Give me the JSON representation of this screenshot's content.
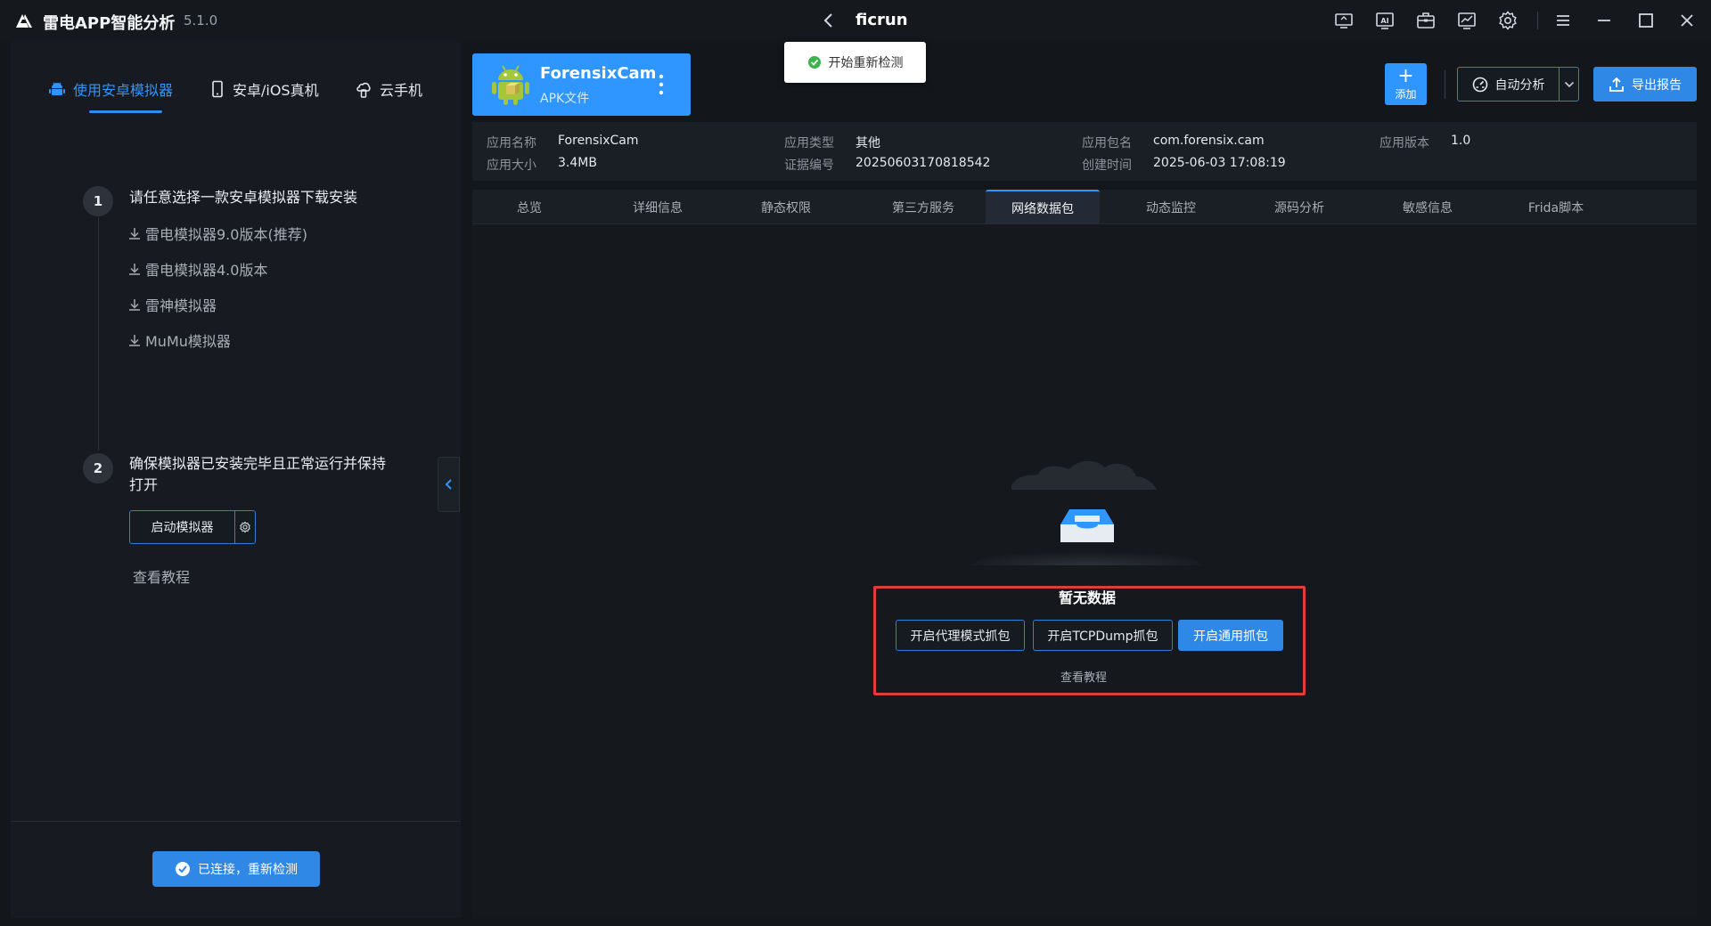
{
  "titlebar": {
    "app_name": "雷电APP智能分析",
    "version": "5.1.0",
    "project_name": "ficrun",
    "icons": [
      "screen-cast-icon",
      "ai-icon",
      "toolbox-icon",
      "monitor-chart-icon",
      "settings-icon",
      "menu-icon",
      "minimize-icon",
      "maximize-icon",
      "close-icon"
    ]
  },
  "left": {
    "tabs": [
      {
        "label": "使用安卓模拟器",
        "icon": "android-icon",
        "active": true
      },
      {
        "label": "安卓/iOS真机",
        "icon": "phone-icon",
        "active": false
      },
      {
        "label": "云手机",
        "icon": "cloud-phone-icon",
        "active": false
      }
    ],
    "step1": {
      "num": "1",
      "title": "请任意选择一款安卓模拟器下载安装",
      "links": [
        "雷电模拟器9.0版本(推荐)",
        "雷电模拟器4.0版本",
        "雷神模拟器",
        "MuMu模拟器"
      ]
    },
    "step2": {
      "num": "2",
      "title_line1": "确保模拟器已安装完毕且正常运行并保持",
      "title_line2": "打开",
      "start_button": "启动模拟器",
      "tutorial": "查看教程"
    },
    "reconnect_button": "已连接，重新检测"
  },
  "toast": {
    "text": "开始重新检测"
  },
  "app_card": {
    "name": "ForensixCam",
    "type": "APK文件"
  },
  "actions": {
    "add_label": "添加",
    "auto_label": "自动分析",
    "export_label": "导出报告"
  },
  "info": {
    "name_label": "应用名称",
    "name_value": "ForensixCam",
    "size_label": "应用大小",
    "size_value": "3.4MB",
    "type_label": "应用类型",
    "type_value": "其他",
    "cert_label": "证据编号",
    "cert_value": "20250603170818542",
    "package_label": "应用包名",
    "package_value": "com.forensix.cam",
    "created_label": "创建时间",
    "created_value": "2025-06-03 17:08:19",
    "version_label": "应用版本",
    "version_value": "1.0"
  },
  "tabs": [
    "总览",
    "详细信息",
    "静态权限",
    "第三方服务",
    "网络数据包",
    "动态监控",
    "源码分析",
    "敏感信息",
    "Frida脚本"
  ],
  "active_tab": "网络数据包",
  "content": {
    "empty_text": "暂无数据",
    "buttons": [
      "开启代理模式抓包",
      "开启TCPDump抓包",
      "开启通用抓包"
    ],
    "tutorial": "查看教程"
  },
  "colors": {
    "accent": "#2f95ff",
    "highlight": "#e23b3b",
    "background": "#13161b"
  }
}
